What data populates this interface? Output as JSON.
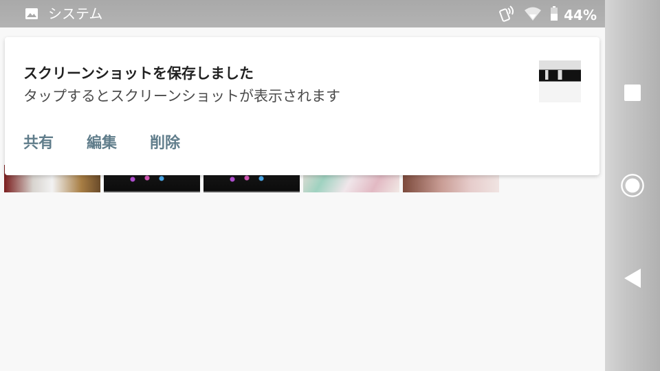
{
  "status_bar": {
    "app_label": "システム",
    "battery": "44%",
    "icons": [
      "image-icon",
      "nfc-icon",
      "wifi-icon",
      "battery-icon"
    ]
  },
  "notification": {
    "title": "スクリーンショットを保存しました",
    "text": "タップするとスクリーンショットが表示されます",
    "actions": [
      "共有",
      "編集",
      "削除"
    ],
    "accent_color": "#607d8b"
  },
  "nav_bar": {
    "buttons": [
      "recent-apps-icon",
      "home-icon",
      "back-icon"
    ]
  }
}
